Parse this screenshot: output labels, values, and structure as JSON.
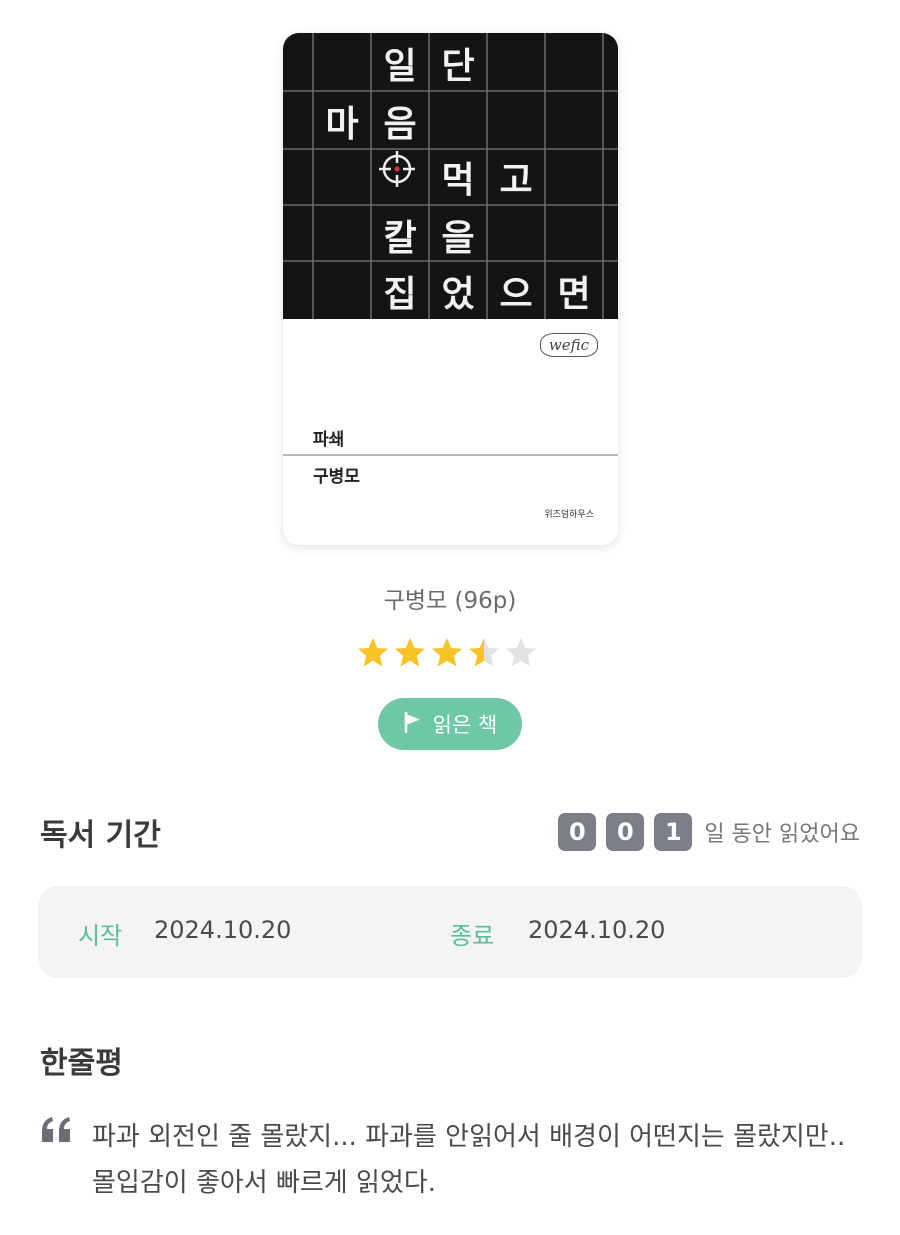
{
  "book": {
    "cover": {
      "grid_lines": [
        [
          "",
          "일",
          "단",
          "",
          ""
        ],
        [
          "마",
          "음",
          "",
          "",
          ""
        ],
        [
          "",
          "",
          "먹",
          "고",
          ""
        ],
        [
          "",
          "칼",
          "을",
          "",
          ""
        ],
        [
          "",
          "집",
          "었",
          "으",
          "면"
        ]
      ],
      "target_symbol_icon": "crosshair-icon",
      "publisher_logo": "wefic",
      "title": "파쇄",
      "author": "구병모",
      "publisher": "위즈덤하우스"
    },
    "meta": "구병모 (96p)",
    "rating": 3.5,
    "rating_max": 5,
    "status_label": "읽은 책",
    "status_icon": "flag-icon"
  },
  "reading_period": {
    "title": "독서 기간",
    "days_digits": [
      "0",
      "0",
      "1"
    ],
    "days_suffix": "일 동안 읽었어요",
    "start_label": "시작",
    "start_date": "2024.10.20",
    "end_label": "종료",
    "end_date": "2024.10.20"
  },
  "review": {
    "title": "한줄평",
    "quote_icon": "quote-icon",
    "text": "파과 외전인 줄 몰랐지... 파과를 안읽어서 배경이 어떤지는 몰랐지만.. 몰입감이 좋아서 빠르게 읽었다."
  },
  "colors": {
    "accent": "#6ec8a6",
    "label_green": "#5bbd98",
    "star_filled": "#f7c325",
    "star_empty": "#e2e2e2",
    "digit_bg": "#7c7f85"
  }
}
